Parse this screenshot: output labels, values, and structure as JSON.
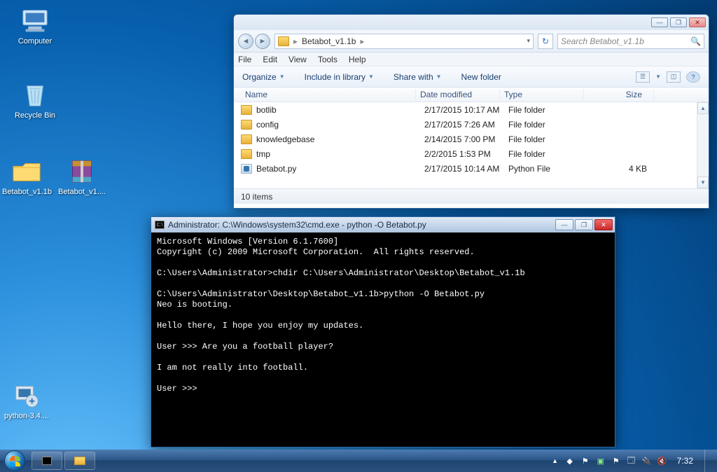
{
  "desktop": {
    "icons": [
      {
        "label": "Computer",
        "type": "computer"
      },
      {
        "label": "Recycle Bin",
        "type": "recycle"
      },
      {
        "label": "Betabot_v1.1b",
        "type": "folder"
      },
      {
        "label": "Betabot_v1....",
        "type": "rar"
      },
      {
        "label": "python-3.4....",
        "type": "py"
      }
    ]
  },
  "explorer": {
    "controls": {
      "min": "—",
      "max": "❐",
      "close": "✕"
    },
    "address": {
      "crumb1": "Betabot_v1.1b",
      "dropdown": "▾"
    },
    "refresh": "↻",
    "search_placeholder": "Search Betabot_v1.1b",
    "menu": [
      "File",
      "Edit",
      "View",
      "Tools",
      "Help"
    ],
    "toolbar": {
      "organize": "Organize",
      "include": "Include in library",
      "share": "Share with",
      "newfolder": "New folder",
      "views": "☰",
      "preview": "◫",
      "help": "?"
    },
    "columns": {
      "name": "Name",
      "date": "Date modified",
      "type": "Type",
      "size": "Size"
    },
    "files": [
      {
        "name": "botlib",
        "date": "2/17/2015 10:17 AM",
        "type": "File folder",
        "size": "",
        "icon": "folder"
      },
      {
        "name": "config",
        "date": "2/17/2015 7:26 AM",
        "type": "File folder",
        "size": "",
        "icon": "folder"
      },
      {
        "name": "knowledgebase",
        "date": "2/14/2015 7:00 PM",
        "type": "File folder",
        "size": "",
        "icon": "folder"
      },
      {
        "name": "tmp",
        "date": "2/2/2015 1:53 PM",
        "type": "File folder",
        "size": "",
        "icon": "folder"
      },
      {
        "name": "Betabot.py",
        "date": "2/17/2015 10:14 AM",
        "type": "Python File",
        "size": "4 KB",
        "icon": "pyfile"
      }
    ],
    "status": "10 items"
  },
  "cmd": {
    "title": "Administrator: C:\\Windows\\system32\\cmd.exe - python  -O Betabot.py",
    "controls": {
      "min": "—",
      "max": "❐",
      "close": "✕"
    },
    "lines": "Microsoft Windows [Version 6.1.7600]\nCopyright (c) 2009 Microsoft Corporation.  All rights reserved.\n\nC:\\Users\\Administrator>chdir C:\\Users\\Administrator\\Desktop\\Betabot_v1.1b\n\nC:\\Users\\Administrator\\Desktop\\Betabot_v1.1b>python -O Betabot.py\nNeo is booting.\n\nHello there, I hope you enjoy my updates.\n\nUser >>> Are you a football player?\n\nI am not really into football.\n\nUser >>> "
  },
  "taskbar": {
    "clock": "7:32"
  }
}
